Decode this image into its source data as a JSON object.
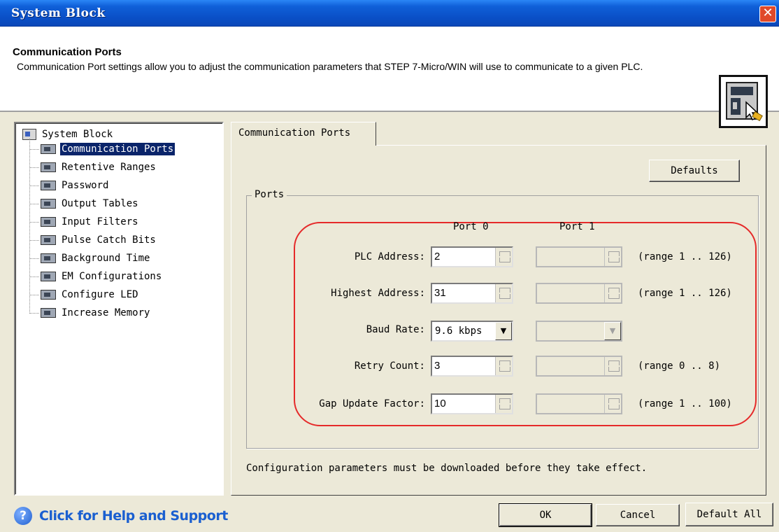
{
  "window": {
    "title": "System Block",
    "close_glyph": "✕"
  },
  "header": {
    "title": "Communication Ports",
    "description": "Communication Port settings allow you to adjust the communication parameters that STEP 7-Micro/WIN will use to communicate to a given PLC.",
    "icon": "system-block-pointer-icon"
  },
  "tree": {
    "root": "System Block",
    "items": [
      {
        "label": "Communication Ports",
        "selected": true
      },
      {
        "label": "Retentive Ranges"
      },
      {
        "label": "Password"
      },
      {
        "label": "Output Tables"
      },
      {
        "label": "Input Filters"
      },
      {
        "label": "Pulse Catch Bits"
      },
      {
        "label": "Background Time"
      },
      {
        "label": "EM Configurations"
      },
      {
        "label": "Configure LED"
      },
      {
        "label": "Increase Memory"
      }
    ]
  },
  "tabs": [
    {
      "label": "Communication Ports",
      "active": true
    }
  ],
  "buttons": {
    "defaults": "Defaults",
    "ok": "OK",
    "cancel": "Cancel",
    "default_all": "Default All"
  },
  "ports": {
    "group_label": "Ports",
    "col_port0": "Port 0",
    "col_port1": "Port 1",
    "rows": [
      {
        "label": "PLC Address:",
        "port0": "2",
        "port1": "",
        "range": "(range 1 .. 126)"
      },
      {
        "label": "Highest Address:",
        "port0": "31",
        "port1": "",
        "range": "(range 1 .. 126)"
      },
      {
        "label": "Baud Rate:",
        "port0": "9.6 kbps",
        "port1": "",
        "range": ""
      },
      {
        "label": "Retry Count:",
        "port0": "3",
        "port1": "",
        "range": "(range 0 .. 8)"
      },
      {
        "label": "Gap Update Factor:",
        "port0": "10",
        "port1": "",
        "range": "(range 1 .. 100)"
      }
    ]
  },
  "note": "Configuration parameters must be downloaded before they take effect.",
  "help": {
    "text": "Click for Help and Support",
    "icon_glyph": "?"
  },
  "colors": {
    "highlight": "#e52a2a",
    "selection": "#0a246a",
    "titlebar": "#0a4fc6",
    "help_link": "#1a5fd0"
  }
}
